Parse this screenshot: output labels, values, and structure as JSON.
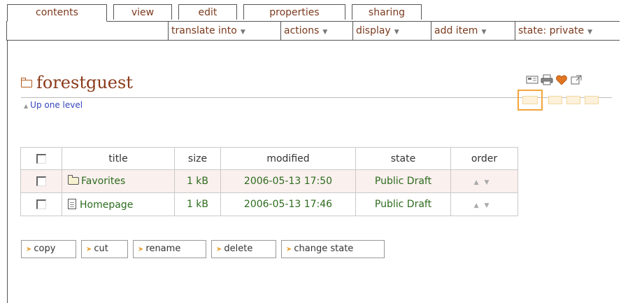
{
  "tabs": [
    "contents",
    "view",
    "edit",
    "properties",
    "sharing"
  ],
  "actions": [
    {
      "label": "translate into"
    },
    {
      "label": "actions"
    },
    {
      "label": "display"
    },
    {
      "label": "add item"
    },
    {
      "label": "state: private"
    }
  ],
  "folder": {
    "title": "forestguest",
    "up_label": "Up one level"
  },
  "doc_icons": [
    "send-to-icon",
    "print-icon",
    "favorite-icon",
    "fullscreen-icon"
  ],
  "view_icons": [
    "folder-listing-icon",
    "summary-view-icon",
    "tabular-view-icon",
    "thumbnail-view-icon"
  ],
  "table": {
    "headers": [
      "title",
      "size",
      "modified",
      "state",
      "order"
    ],
    "rows": [
      {
        "title": "Favorites",
        "type": "folder",
        "size": "1 kB",
        "modified": "2006-05-13 17:50",
        "state": "Public Draft"
      },
      {
        "title": "Homepage",
        "type": "document",
        "size": "1 kB",
        "modified": "2006-05-13 17:46",
        "state": "Public Draft"
      }
    ]
  },
  "buttons": [
    "copy",
    "cut",
    "rename",
    "delete",
    "change state"
  ],
  "colors": {
    "tab_text": "#7a3a1e",
    "link": "#3344bb",
    "cell_link": "#2d6b1e",
    "title": "#8a3a1a",
    "view_highlight": "#f3a53c"
  }
}
